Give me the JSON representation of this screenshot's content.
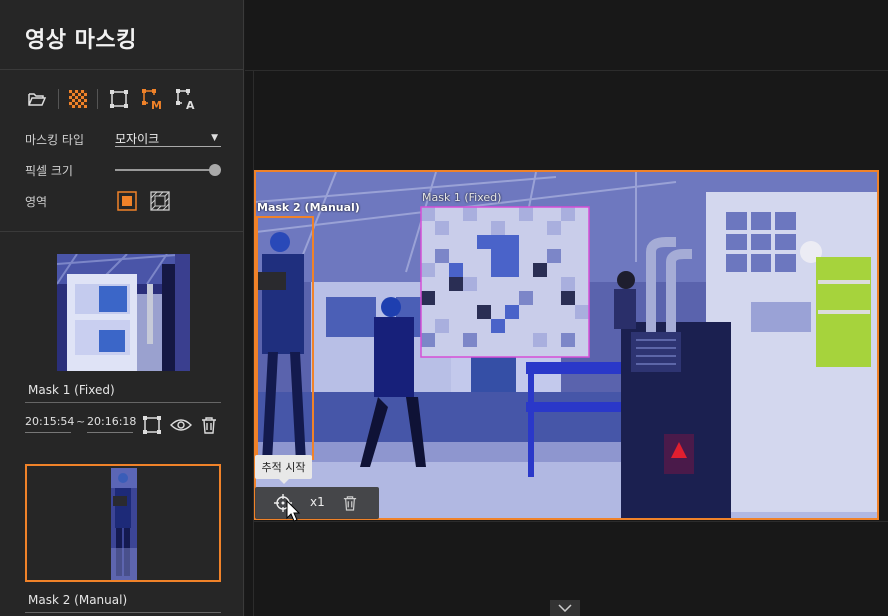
{
  "app": {
    "title": "영상 마스킹"
  },
  "toolbar": {
    "icons": [
      "folder-open-icon",
      "mosaic-pattern-icon",
      "rectangle-icon",
      "manual-mask-icon",
      "auto-mask-icon"
    ],
    "manual_letter": "M",
    "auto_letter": "A"
  },
  "settings": {
    "masking_type_label": "마스킹 타입",
    "masking_type_value": "모자이크",
    "pixel_size_label": "픽셀 크기",
    "pixel_size_level": 1.0,
    "area_label": "영역"
  },
  "masks": [
    {
      "name": "Mask 1 (Fixed)",
      "start_time": "20:15:54",
      "end_time": "20:16:18",
      "time_separator": "~"
    },
    {
      "name": "Mask 2 (Manual)"
    }
  ],
  "video": {
    "mask_labels": [
      {
        "text": "Mask 2 (Manual)",
        "color": "#ffffff"
      },
      {
        "text": "Mask 1 (Fixed)",
        "color": "#e6e6e6"
      }
    ],
    "tooltip": "추적 시작",
    "speed": "x1"
  },
  "colors": {
    "accent": "#f08229",
    "mask_fixed": "#d64fd6",
    "sidebar_bg": "#262626",
    "main_bg": "#181818"
  }
}
